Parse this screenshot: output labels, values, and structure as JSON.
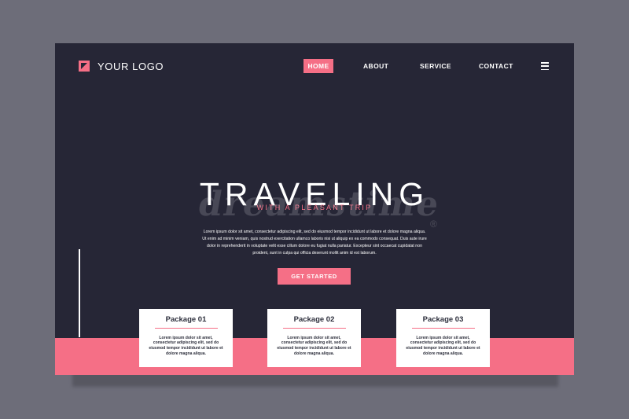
{
  "brand": {
    "logo_text": "YOUR LOGO"
  },
  "nav": {
    "items": [
      {
        "label": "HOME"
      },
      {
        "label": "ABOUT"
      },
      {
        "label": "SERVICE"
      },
      {
        "label": "CONTACT"
      }
    ],
    "menu_icon": "hamburger-menu-icon"
  },
  "hero": {
    "title": "TRAVELING",
    "subtitle": "WITH A PLEASANT TRIP",
    "body": "Lorem ipsum dolor sit amet, consectetur adipiscing elit, sed do eiusmod tempor incididunt ut labore et dolore magna aliqua. Ut enim ad minim veniam, quis nostrud exercitation ullamco laboris nisi ut aliquip ex ea commodo consequat. Duis aute irure dolor in reprehenderit in voluptate velit esse cillum dolore eu fugiat nulla pariatur. Excepteur sint occaecat cupidatat non proident, sunt in culpa qui officia deserunt mollit anim id est laborum.",
    "cta_label": "GET STARTED"
  },
  "packages": [
    {
      "title": "Package 01",
      "body": "Lorem ipsum dolor sit amet, consectetur adipiscing elit, sed do eiusmod tempor incididunt ut labore et dolore magna aliqua."
    },
    {
      "title": "Package 02",
      "body": "Lorem ipsum dolor sit amet, consectetur adipiscing elit, sed do eiusmod tempor incididunt ut labore et dolore magna aliqua."
    },
    {
      "title": "Package 03",
      "body": "Lorem ipsum dolor sit amet, consectetur adipiscing elit, sed do eiusmod tempor incididunt ut labore et dolore magna aliqua."
    }
  ],
  "watermark": {
    "text": "dreamstime",
    "mark": "®"
  },
  "colors": {
    "background": "#6d6d79",
    "page": "#262636",
    "accent": "#f56f86",
    "text": "#ffffff",
    "card_text": "#2d2f3c"
  }
}
